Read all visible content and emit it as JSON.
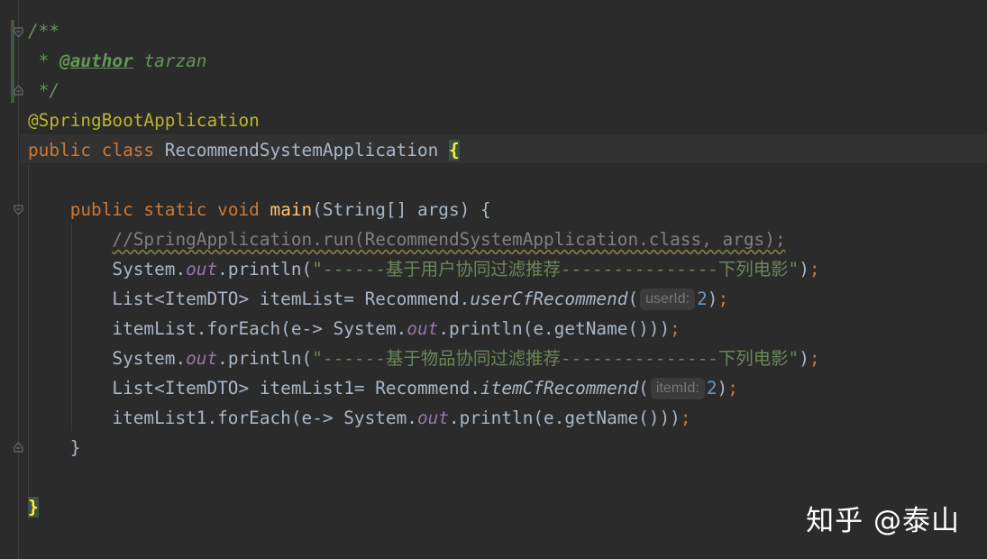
{
  "editor": {
    "lines": [
      {
        "parts": [
          {
            "c": "cmt",
            "t": "/**"
          }
        ]
      },
      {
        "parts": [
          {
            "c": "cmt",
            "t": " * "
          },
          {
            "c": "tag",
            "t": "@author"
          },
          {
            "c": "cmt",
            "t": " tarzan"
          }
        ]
      },
      {
        "parts": [
          {
            "c": "cmt",
            "t": " */"
          }
        ]
      },
      {
        "parts": [
          {
            "c": "ann",
            "t": "@SpringBootApplication"
          }
        ]
      },
      {
        "parts": [
          {
            "c": "kw",
            "t": "public class "
          },
          {
            "c": "cn",
            "t": "RecommendSystemApplication "
          },
          {
            "c": "brace-hl",
            "t": "{"
          }
        ]
      },
      {
        "parts": []
      },
      {
        "parts": [
          {
            "c": "",
            "t": "    "
          },
          {
            "c": "kw",
            "t": "public static void "
          },
          {
            "c": "fn",
            "t": "main"
          },
          {
            "c": "",
            "t": "(String[] args) {"
          }
        ]
      },
      {
        "parts": [
          {
            "c": "",
            "t": "        "
          },
          {
            "c": "line-cmt",
            "t": "//SpringApplication.run(RecommendSystemApplication.class, args);"
          }
        ]
      },
      {
        "parts": [
          {
            "c": "",
            "t": "        System."
          },
          {
            "c": "st",
            "t": "out"
          },
          {
            "c": "",
            "t": ".println("
          },
          {
            "c": "str",
            "t": "\"------基于用户协同过滤推荐---------------下列电影\""
          },
          {
            "c": "",
            "t": ")"
          },
          {
            "c": "kw",
            "t": ";"
          }
        ]
      },
      {
        "parts": [
          {
            "c": "",
            "t": "        List<ItemDTO> itemList= Recommend."
          },
          {
            "c": "ital",
            "t": "userCfRecommend"
          },
          {
            "c": "",
            "t": "("
          },
          {
            "c": "hint",
            "t": "userId:"
          },
          {
            "c": "num",
            "t": "2"
          },
          {
            "c": "",
            "t": ")"
          },
          {
            "c": "kw",
            "t": ";"
          }
        ]
      },
      {
        "parts": [
          {
            "c": "",
            "t": "        itemList.forEach(e-> System."
          },
          {
            "c": "st",
            "t": "out"
          },
          {
            "c": "",
            "t": ".println(e.getName()))"
          },
          {
            "c": "kw",
            "t": ";"
          }
        ]
      },
      {
        "parts": [
          {
            "c": "",
            "t": "        System."
          },
          {
            "c": "st",
            "t": "out"
          },
          {
            "c": "",
            "t": ".println("
          },
          {
            "c": "str",
            "t": "\"------基于物品协同过滤推荐---------------下列电影\""
          },
          {
            "c": "",
            "t": ")"
          },
          {
            "c": "kw",
            "t": ";"
          }
        ]
      },
      {
        "parts": [
          {
            "c": "",
            "t": "        List<ItemDTO> itemList1= Recommend."
          },
          {
            "c": "ital",
            "t": "itemCfRecommend"
          },
          {
            "c": "",
            "t": "("
          },
          {
            "c": "hint",
            "t": "itemId:"
          },
          {
            "c": "num",
            "t": "2"
          },
          {
            "c": "",
            "t": ")"
          },
          {
            "c": "kw",
            "t": ";"
          }
        ]
      },
      {
        "parts": [
          {
            "c": "",
            "t": "        itemList1.forEach(e-> System."
          },
          {
            "c": "st",
            "t": "out"
          },
          {
            "c": "",
            "t": ".println(e.getName()))"
          },
          {
            "c": "kw",
            "t": ";"
          }
        ]
      },
      {
        "parts": [
          {
            "c": "",
            "t": "    }"
          }
        ]
      },
      {
        "parts": []
      },
      {
        "parts": [
          {
            "c": "brace-hl",
            "t": "}"
          }
        ]
      }
    ]
  },
  "watermark": {
    "text": "知乎 @泰山"
  },
  "colors": {
    "background": "#2b2b2b",
    "keyword": "#cc7832",
    "comment": "#629755",
    "string": "#6a8759",
    "annotation": "#bbb529",
    "method": "#ffc66d",
    "static_field": "#9876aa",
    "number": "#6897bb",
    "text": "#a9b7c6"
  }
}
